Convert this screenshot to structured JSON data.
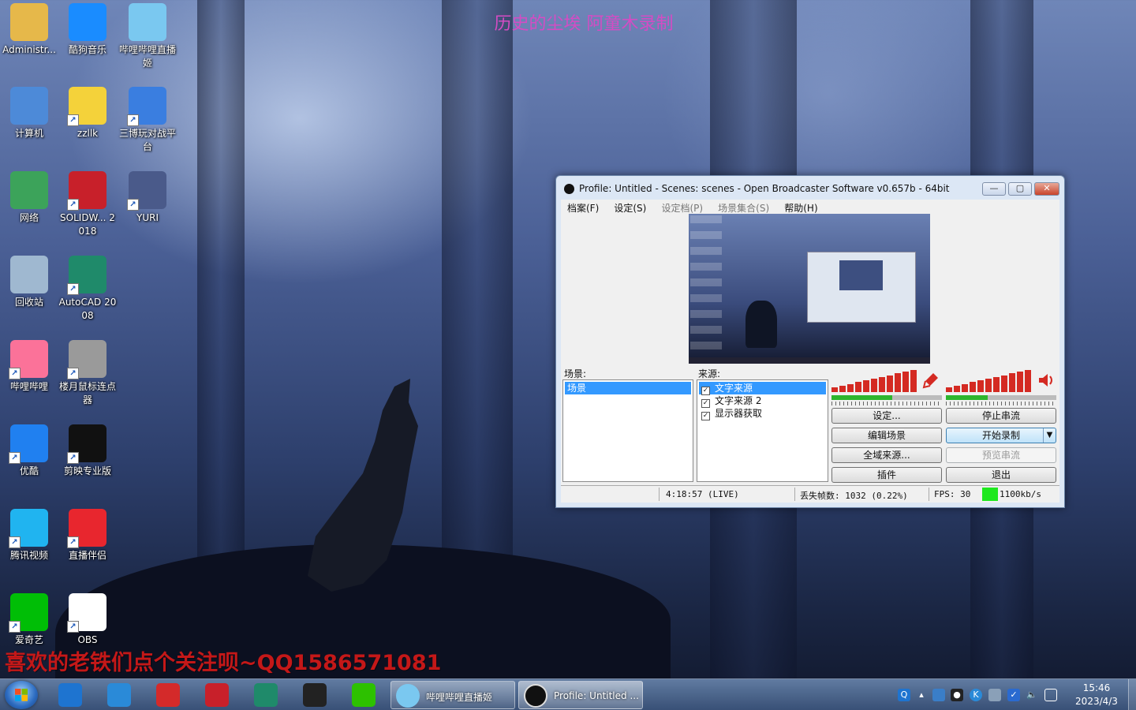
{
  "overlay": {
    "title": "历史的尘埃  阿童木录制",
    "bottom_text": "喜欢的老铁们点个关注呗~QQ1586571081"
  },
  "desktop_icons": [
    {
      "label": "Administr...",
      "icon": "folder-user-icon",
      "color": "#e6b84a"
    },
    {
      "label": "酷狗音乐",
      "icon": "kugou-icon",
      "color": "#1a8cff"
    },
    {
      "label": "哔哩哔哩直播姬",
      "icon": "bilibili-live-icon",
      "color": "#7ac8f0"
    },
    {
      "label": "计算机",
      "icon": "computer-icon",
      "color": "#4d8ad8"
    },
    {
      "label": "zzllk",
      "icon": "pikachu-icon",
      "color": "#f4d23a"
    },
    {
      "label": "三博玩对战平台",
      "icon": "platform-icon",
      "color": "#3a7ee0"
    },
    {
      "label": "网络",
      "icon": "network-icon",
      "color": "#3ca35a"
    },
    {
      "label": "SOLIDW... 2018",
      "icon": "solidworks-icon",
      "color": "#c8202a"
    },
    {
      "label": "YURI",
      "icon": "yuri-icon",
      "color": "#4a5a8a"
    },
    {
      "label": "回收站",
      "icon": "recycle-bin-icon",
      "color": "#9fb8d0"
    },
    {
      "label": "AutoCAD 2008",
      "icon": "autocad-icon",
      "color": "#1f8a6a"
    },
    {
      "label": "哔哩哔哩",
      "icon": "bilibili-icon",
      "color": "#fb7299"
    },
    {
      "label": "楼月鼠标连点器",
      "icon": "mouse-clicker-icon",
      "color": "#9a9a9a"
    },
    {
      "label": "优酷",
      "icon": "youku-icon",
      "color": "#2080f0"
    },
    {
      "label": "剪映专业版",
      "icon": "capcut-icon",
      "color": "#111111"
    },
    {
      "label": "腾讯视频",
      "icon": "tencent-video-icon",
      "color": "#20b4f0"
    },
    {
      "label": "直播伴侣",
      "icon": "live-companion-icon",
      "color": "#e8262e"
    },
    {
      "label": "爱奇艺",
      "icon": "iqiyi-icon",
      "color": "#00be06"
    },
    {
      "label": "OBS",
      "icon": "obs-icon",
      "color": "#ffffff"
    }
  ],
  "obs": {
    "title": "Profile: Untitled - Scenes: scenes - Open Broadcaster Software v0.657b - 64bit",
    "menu": [
      {
        "label": "档案(F)",
        "enabled": true
      },
      {
        "label": "设定(S)",
        "enabled": true
      },
      {
        "label": "设定档(P)",
        "enabled": false
      },
      {
        "label": "场景集合(S)",
        "enabled": false
      },
      {
        "label": "帮助(H)",
        "enabled": true
      }
    ],
    "scenes_label": "场景:",
    "scenes": [
      "场景"
    ],
    "sources_label": "来源:",
    "sources": [
      {
        "name": "文字来源",
        "checked": true,
        "selected": true
      },
      {
        "name": "文字来源 2",
        "checked": true,
        "selected": false
      },
      {
        "name": "显示器获取",
        "checked": true,
        "selected": false
      }
    ],
    "buttons": {
      "settings": "设定...",
      "stop_stream": "停止串流",
      "edit_scene": "编辑场景",
      "start_record": "开始录制",
      "global_sources": "全域来源...",
      "preview_stream": "预览串流",
      "plugins": "插件",
      "exit": "退出"
    },
    "status": {
      "time": "4:18:57 (LIVE)",
      "dropped_frames": "丢失帧数: 1032 (0.22%)",
      "fps": "FPS: 30",
      "bitrate": "1100kb/s",
      "bitrate_color": "#1ee81e"
    },
    "mic_level": 0.55,
    "desktop_level": 0.38
  },
  "taskbar": {
    "pinned": [
      {
        "icon": "ie-icon",
        "color": "#1e74d0"
      },
      {
        "icon": "browser-icon",
        "color": "#2a8ad8"
      },
      {
        "icon": "red-app-icon",
        "color": "#d42a2a"
      },
      {
        "icon": "solidworks-icon",
        "color": "#c8202a"
      },
      {
        "icon": "autocad-icon",
        "color": "#1f8a6a"
      },
      {
        "icon": "qq-icon",
        "color": "#222222"
      },
      {
        "icon": "wechat-icon",
        "color": "#2dc100"
      }
    ],
    "tasks": [
      {
        "label": "哔哩哔哩直播姬",
        "icon": "bilibili-live-icon",
        "color": "#7ac8f0"
      },
      {
        "label": "Profile: Untitled ...",
        "icon": "obs-icon",
        "color": "#111111"
      }
    ],
    "clock_time": "15:46",
    "clock_date": "2023/4/3"
  }
}
